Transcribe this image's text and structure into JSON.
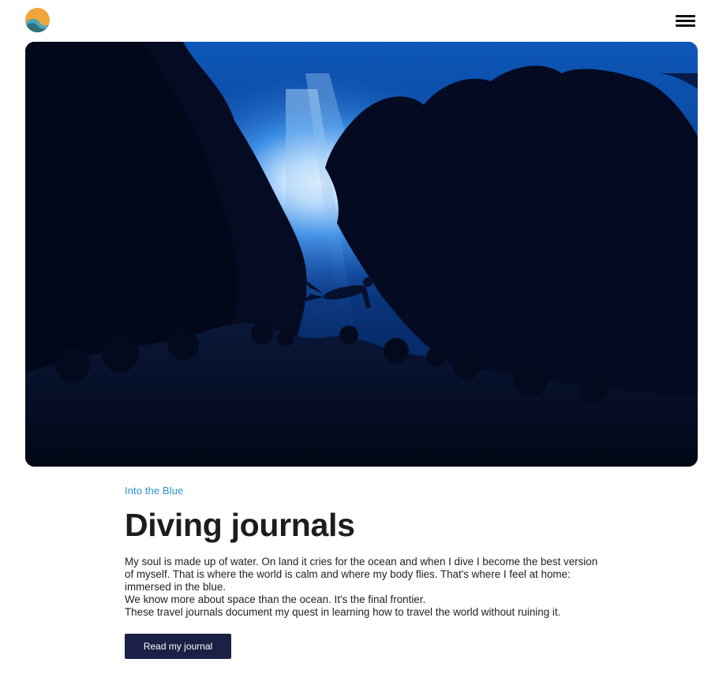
{
  "header": {
    "logo_icon": "wave-logo-icon",
    "menu_icon": "hamburger-menu-icon"
  },
  "hero": {
    "image_description_icon": "underwater-diver-image"
  },
  "content": {
    "eyebrow": "Into the Blue",
    "title": "Diving journals",
    "paragraphs": [
      "My soul is made up of water. On land it cries for the ocean and when I dive I become the best version of myself. That is where the world is calm and where my body flies. That's where I feel at home: immersed in the blue.",
      "We know more about space than the ocean. It's the final frontier.",
      "These travel journals document my quest in learning how to travel the world without ruining it."
    ],
    "cta_label": "Read my journal"
  },
  "colors": {
    "accent": "#2a93c6",
    "button": "#1b2046",
    "logo_orange": "#f0a63a",
    "logo_teal": "#2f7a86"
  }
}
